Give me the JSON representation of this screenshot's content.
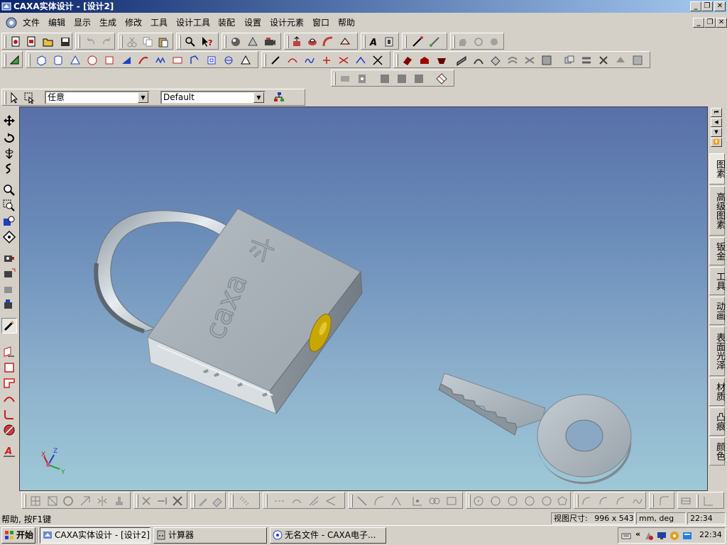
{
  "window": {
    "title": "CAXA实体设计 - [设计2]",
    "controls": [
      "_",
      "❐",
      "✕"
    ]
  },
  "menu": [
    "文件",
    "编辑",
    "显示",
    "生成",
    "修改",
    "工具",
    "设计工具",
    "装配",
    "设置",
    "设计元素",
    "窗口",
    "帮助"
  ],
  "selection_bar": {
    "filter_value": "任意",
    "style_value": "Default"
  },
  "design_panel": {
    "tabs": [
      "图素",
      "高级图素",
      "钣金",
      "工具",
      "动画",
      "表面光泽",
      "材质",
      "凸痕",
      "颜色"
    ]
  },
  "status": {
    "help_text": "帮助, 按F1键",
    "view_size_label": "视图尺寸:",
    "view_size_value": "996 x 543",
    "units": "mm, deg",
    "time": "22:34"
  },
  "taskbar": {
    "start_label": "开始",
    "tasks": [
      "CAXA实体设计 - [设计2]",
      "计算器",
      "无名文件 - CAXA电子..."
    ],
    "clock": "22:34"
  },
  "model": {
    "lock_engraving_cn": "斗",
    "lock_engraving_brand": "caxa",
    "axis_labels": [
      "X",
      "Y",
      "Z"
    ]
  },
  "colors": {
    "viewport_top": "#5870a8",
    "viewport_bottom": "#9ec8d6",
    "titlebar_start": "#0a246a",
    "titlebar_end": "#a6caf0",
    "keyhole": "#c8a800",
    "metal": "#aeb6bc"
  }
}
